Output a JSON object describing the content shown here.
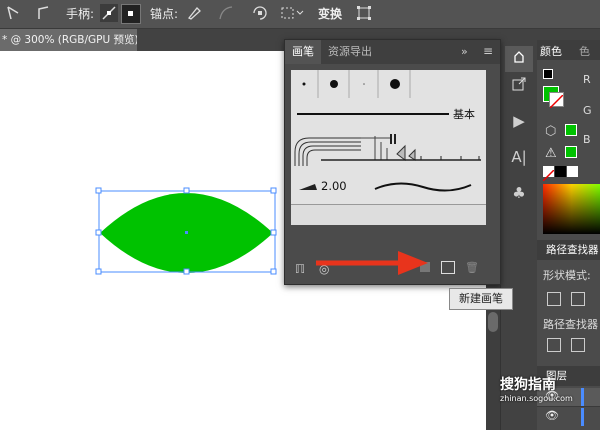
{
  "toolbar": {
    "handle_label": "手柄:",
    "anchor_label": "锚点:",
    "transform_label": "变换"
  },
  "document": {
    "tab_title": "* @ 300% (RGB/GPU 预览)"
  },
  "brush_panel": {
    "tabs": [
      {
        "label": "画笔"
      },
      {
        "label": "资源导出"
      }
    ],
    "basic_label": "基本",
    "size_value": "2.00",
    "tooltip": "新建画笔"
  },
  "right_panel": {
    "color_tab": "颜色",
    "color_tab2": "色",
    "letters": [
      "R",
      "G",
      "B"
    ],
    "pathfinder_title": "路径查找器",
    "shape_modes": "形状模式:",
    "pathfinder_label": "路径查找器",
    "layers_title": "图层"
  },
  "watermark": {
    "brand": "搜狗指南",
    "url": "zhinan.sogou.com"
  },
  "colors": {
    "accent_fill": "#00c200",
    "selection": "#4a8cff",
    "arrow": "#e8341c"
  }
}
